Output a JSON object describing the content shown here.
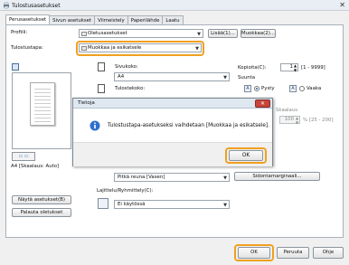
{
  "window": {
    "title": "Tulostusasetukset",
    "close_glyph": "✕"
  },
  "tabs": [
    "Perusasetukset",
    "Sivun asetukset",
    "Viimeistely",
    "Paperilähde",
    "Laatu"
  ],
  "profile": {
    "label": "Profiili:",
    "value": "Oletusasetukset",
    "add_button": "Lisää(1)...",
    "edit_button": "Muokkaa(2)..."
  },
  "output_method": {
    "label": "Tulostustapa:",
    "value": "Muokkaa ja esikatsele"
  },
  "page_size": {
    "label": "Sivukoko:",
    "value": "A4"
  },
  "output_size": {
    "label": "Tulostekoko:"
  },
  "copies": {
    "label": "Kopioita(C):",
    "value": "1",
    "range": "[1 - 9999]"
  },
  "orientation": {
    "label": "Suunta",
    "portrait": "Pysty",
    "landscape": "Vaaka"
  },
  "zoom": {
    "label": "Skaalaus",
    "value": "100",
    "range": "% [25 - 200]"
  },
  "preview": {
    "caption": "A4 [Skaalaus: Auto]"
  },
  "binding": {
    "value": "Pitkä reuna [Vasen]"
  },
  "layout": {
    "label": "Lajittelu/Ryhmittely(C):",
    "value": "Ei käytössä"
  },
  "buttons": {
    "view_settings": "Näytä asetukset(B)",
    "restore_defaults": "Palauta oletukset",
    "margin": "Sidontamarginaali...",
    "ok": "OK",
    "cancel": "Peruuta",
    "help": "Ohje"
  },
  "dialog": {
    "title": "Tietoja",
    "message": "Tulostustapa-asetukseksi vaihdetaan [Muokkaa ja esikatsele].",
    "ok": "OK",
    "close_glyph": "✕"
  }
}
